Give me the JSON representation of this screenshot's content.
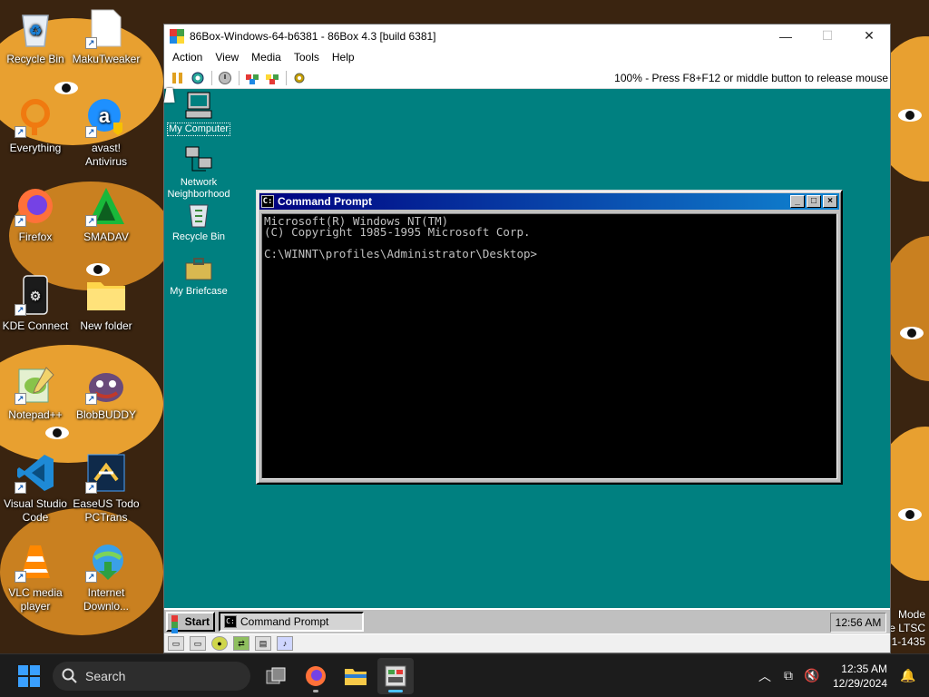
{
  "host_desktop": {
    "icons": [
      {
        "label": "Recycle Bin",
        "icon": "recycle-bin-icon",
        "shortcut": false
      },
      {
        "label": "MakuTweaker",
        "icon": "document-icon",
        "shortcut": true
      },
      {
        "label": "Everything",
        "icon": "everything-search-icon",
        "shortcut": true
      },
      {
        "label": "avast! Antivirus",
        "icon": "avast-icon",
        "shortcut": true
      },
      {
        "label": "Firefox",
        "icon": "firefox-icon",
        "shortcut": true
      },
      {
        "label": "SMADAV",
        "icon": "smadav-icon",
        "shortcut": true
      },
      {
        "label": "KDE Connect",
        "icon": "kde-connect-icon",
        "shortcut": true
      },
      {
        "label": "New folder",
        "icon": "folder-icon",
        "shortcut": false
      },
      {
        "label": "Notepad++",
        "icon": "notepadpp-icon",
        "shortcut": true
      },
      {
        "label": "BlobBUDDY",
        "icon": "blobbuddy-icon",
        "shortcut": true
      },
      {
        "label": "Visual Studio Code",
        "icon": "vscode-icon",
        "shortcut": true
      },
      {
        "label": "EaseUS Todo PCTrans",
        "icon": "easeus-icon",
        "shortcut": true
      },
      {
        "label": "VLC media player",
        "icon": "vlc-icon",
        "shortcut": true
      },
      {
        "label": "Internet Downlo...",
        "icon": "idm-icon",
        "shortcut": true
      }
    ],
    "edition_watermark": [
      "Mode",
      "e LTSC",
      "1-1435"
    ]
  },
  "box_window": {
    "title": "86Box-Windows-64-b6381 - 86Box 4.3 [build 6381]",
    "menu": [
      "Action",
      "View",
      "Media",
      "Tools",
      "Help"
    ],
    "toolbar_icons": [
      "pause-icon",
      "reset-icon",
      "power-icon",
      "ctrl-alt-del-icon",
      "ctrl-alt-esc-icon",
      "settings-icon"
    ],
    "status_message": "100% - Press F8+F12 or middle button to release mouse",
    "status_icons": [
      "floppy-icon",
      "floppy-icon",
      "cdrom-icon",
      "network-icon",
      "hdd-icon",
      "sound-icon"
    ]
  },
  "vm": {
    "desktop_icons": [
      {
        "label": "My Computer",
        "icon": "my-computer-icon"
      },
      {
        "label": "Network Neighborhood",
        "icon": "network-neighborhood-icon"
      },
      {
        "label": "Recycle Bin",
        "icon": "recycle-bin-icon"
      },
      {
        "label": "My Briefcase",
        "icon": "briefcase-icon"
      }
    ],
    "cmd": {
      "title": "Command Prompt",
      "lines": [
        "Microsoft(R) Windows NT(TM)",
        "(C) Copyright 1985-1995 Microsoft Corp.",
        "",
        "C:\\WINNT\\profiles\\Administrator\\Desktop>"
      ]
    },
    "taskbar": {
      "start_label": "Start",
      "task_label": "Command Prompt",
      "clock": "12:56 AM"
    }
  },
  "host_taskbar": {
    "search_placeholder": "Search",
    "apps": [
      "task-view-icon",
      "firefox-icon",
      "file-explorer-icon",
      "86box-icon"
    ],
    "clock_time": "12:35 AM",
    "clock_date": "12/29/2024"
  }
}
